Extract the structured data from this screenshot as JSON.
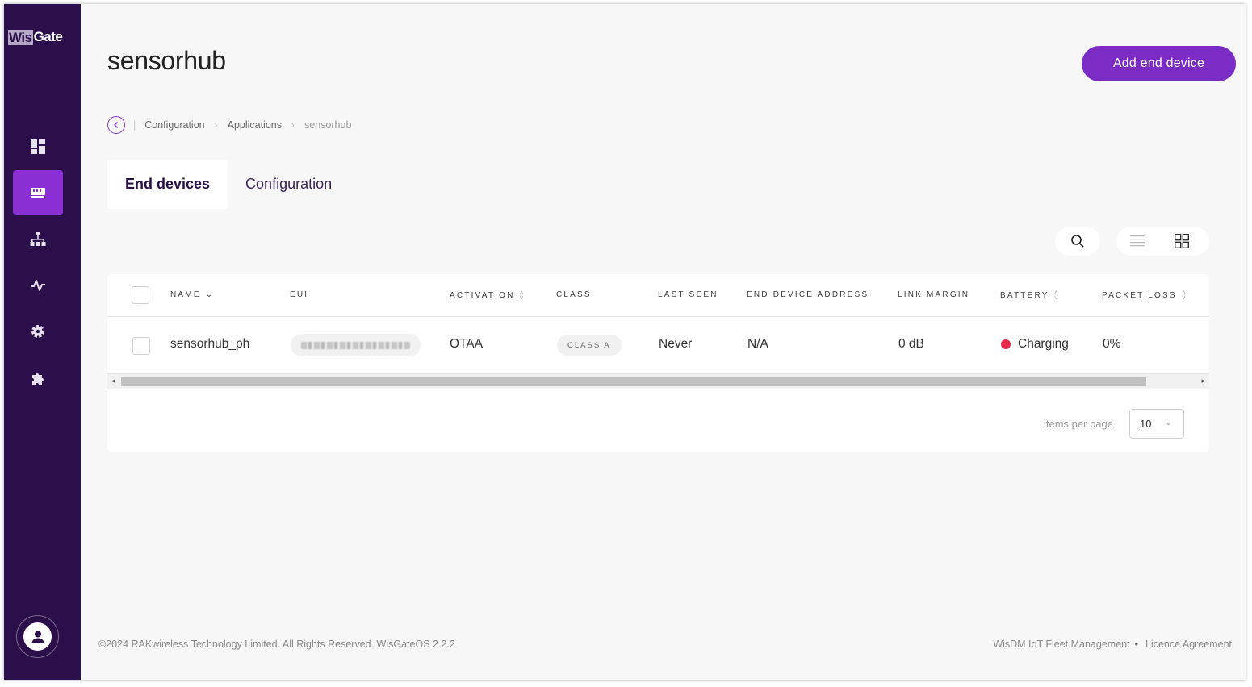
{
  "brand": {
    "part1": "Wis",
    "part2": "Gate"
  },
  "sidebar": {
    "items": [
      {
        "name": "dashboard",
        "icon": "dashboard-icon",
        "active": false
      },
      {
        "name": "gateway",
        "icon": "gateway-icon",
        "active": true
      },
      {
        "name": "network",
        "icon": "network-icon",
        "active": false
      },
      {
        "name": "activity",
        "icon": "activity-icon",
        "active": false
      },
      {
        "name": "settings",
        "icon": "gear-icon",
        "active": false
      },
      {
        "name": "extensions",
        "icon": "puzzle-icon",
        "active": false
      }
    ],
    "user_icon": "user-icon"
  },
  "header": {
    "title": "sensorhub",
    "add_button": "Add end device"
  },
  "breadcrumb": {
    "items": [
      "Configuration",
      "Applications"
    ],
    "current": "sensorhub"
  },
  "tabs": [
    {
      "label": "End devices",
      "active": true
    },
    {
      "label": "Configuration",
      "active": false
    }
  ],
  "toolbar": {
    "search_icon": "search-icon",
    "list_view_icon": "list-view-icon",
    "grid_view_icon": "grid-view-icon"
  },
  "table": {
    "columns": {
      "name": "NAME",
      "eui": "EUI",
      "activation": "ACTIVATION",
      "class": "CLASS",
      "last_seen": "LAST SEEN",
      "address": "END DEVICE ADDRESS",
      "link_margin": "LINK MARGIN",
      "battery": "BATTERY",
      "packet_loss": "PACKET LOSS"
    },
    "rows": [
      {
        "name": "sensorhub_ph",
        "activation": "OTAA",
        "class": "CLASS A",
        "last_seen": "Never",
        "address": "N/A",
        "link_margin": "0 dB",
        "battery": "Charging",
        "battery_color": "#e8294c",
        "packet_loss": "0%"
      }
    ]
  },
  "pagination": {
    "label": "items per page",
    "value": "10"
  },
  "footer": {
    "copyright": "©2024 RAKwireless Technology Limited. All Rights Reserved. WisGateOS 2.2.2",
    "link1": "WisDM IoT Fleet Management",
    "link2": "Licence Agreement"
  },
  "colors": {
    "sidebar": "#2b0f4a",
    "accent": "#7b2cc4",
    "active_nav": "#8a2fd4"
  }
}
